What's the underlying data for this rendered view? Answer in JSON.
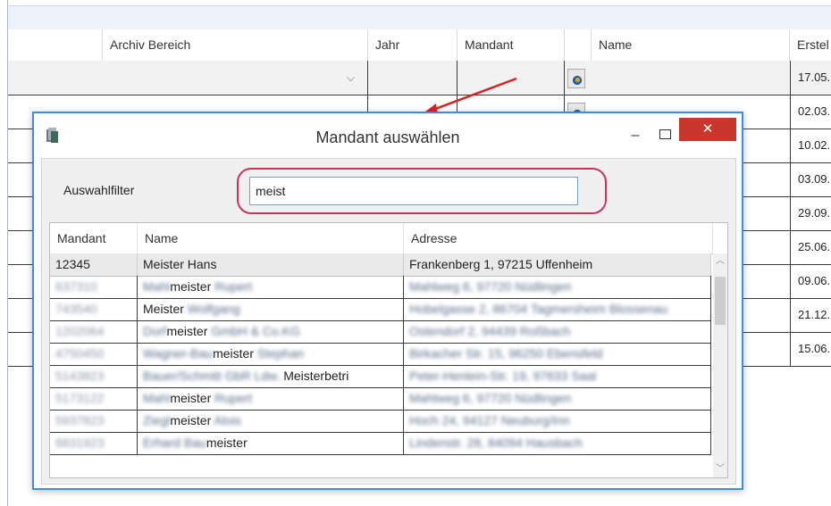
{
  "background": {
    "columns": [
      "Archiv Bereich",
      "Jahr",
      "Mandant",
      "Name",
      "Erstel"
    ],
    "dates": [
      "17.05.",
      "02.03.",
      "10.02.",
      "03.09.",
      "29.09.",
      "25.06.",
      "09.06.",
      "21.12.",
      "15.06."
    ]
  },
  "dialog": {
    "title": "Mandant auswählen",
    "minimize": "–",
    "close": "✕",
    "filter_label": "Auswahlfilter",
    "filter_value": "meist",
    "grid": {
      "headers": [
        "Mandant",
        "Name",
        "Adresse"
      ],
      "rows": [
        {
          "mandant": "12345",
          "name_pre": "",
          "name_bold": "Meister Hans",
          "name_post": "",
          "adresse": "Frankenberg 1, 97215 Uffenheim"
        },
        {
          "mandant": "637310",
          "name_pre": "Mahl",
          "name_bold": "meister",
          "name_post": " Rupert",
          "adresse": "Mahlweg 6, 97720 Nüdlingen"
        },
        {
          "mandant": "743540",
          "name_pre": "",
          "name_bold": "Meister",
          "name_post": " Wolfgang",
          "adresse": "Hobelgasse 2, 86704 Tagmersheim Blossenau"
        },
        {
          "mandant": "1202064",
          "name_pre": "Dorf",
          "name_bold": "meister",
          "name_post": " GmbH & Co.KG",
          "adresse": "Ostendorf 2, 94439 Roßbach"
        },
        {
          "mandant": "4750450",
          "name_pre": "Wagner-Bau",
          "name_bold": "meister",
          "name_post": " Stephan",
          "adresse": "Birkacher Str. 15, 96250 Ebensfeld"
        },
        {
          "mandant": "5143823",
          "name_pre": "Bauer/Schmitt GbR Ldw. ",
          "name_bold": "Meisterbetri",
          "name_post": "",
          "adresse": "Peter-Henlein-Str. 19, 97633 Saal"
        },
        {
          "mandant": "5173122",
          "name_pre": "Mahl",
          "name_bold": "meister",
          "name_post": " Rupert",
          "adresse": "Mahlweg 6, 97720 Nüdlingen"
        },
        {
          "mandant": "5937823",
          "name_pre": "Ziegl",
          "name_bold": "meister",
          "name_post": " Alois",
          "adresse": "Hoch 24, 94127 Neuburg/Inn"
        },
        {
          "mandant": "6831923",
          "name_pre": "Erhard Bau",
          "name_bold": "meister",
          "name_post": "",
          "adresse": "Lindenstr. 28, 84094 Hausbach"
        }
      ]
    }
  },
  "icons": [
    "app-icon",
    "lookup-icon",
    "chevron-down-icon",
    "scroll-up-icon",
    "scroll-down-icon"
  ]
}
